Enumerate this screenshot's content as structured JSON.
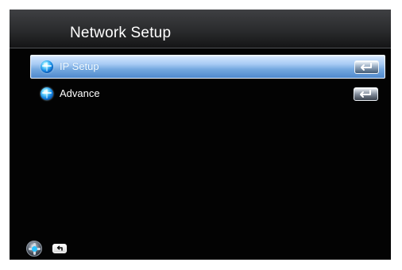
{
  "app": {
    "title": "Network Setup"
  },
  "menu": {
    "items": [
      {
        "label": "IP Setup",
        "icon": "network-globe-icon",
        "action_icon": "enter-icon",
        "selected": true
      },
      {
        "label": "Advance",
        "icon": "network-globe-icon",
        "action_icon": "enter-icon",
        "selected": false
      }
    ]
  },
  "footer": {
    "navigation_icon": "remote-navigation-icon",
    "back_icon": "back-icon"
  },
  "colors": {
    "background": "#030303",
    "header": "#2a2b2d",
    "selection": "#74a8df",
    "text": "#ffffff"
  }
}
